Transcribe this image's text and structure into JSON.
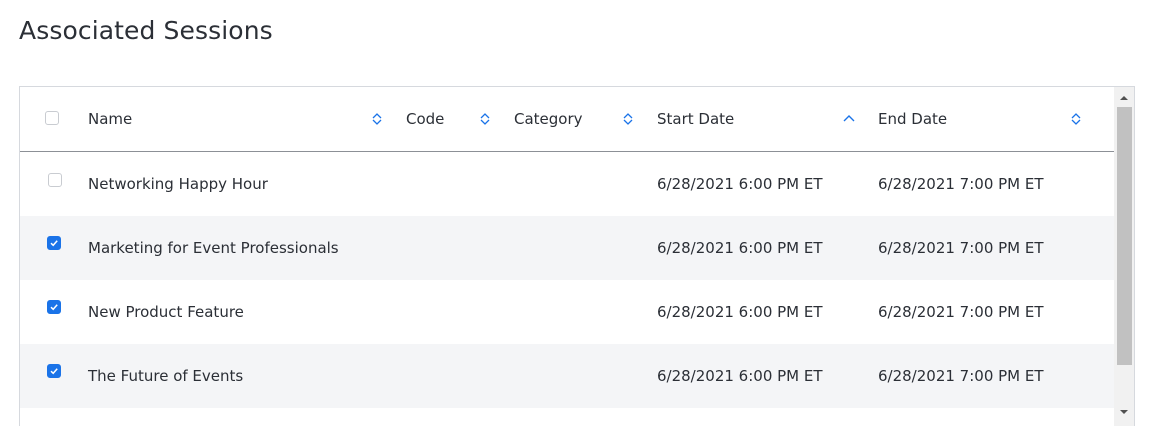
{
  "page": {
    "title": "Associated Sessions"
  },
  "table": {
    "columns": [
      {
        "key": "name",
        "label": "Name",
        "sort": "none"
      },
      {
        "key": "code",
        "label": "Code",
        "sort": "none"
      },
      {
        "key": "category",
        "label": "Category",
        "sort": "none"
      },
      {
        "key": "start",
        "label": "Start Date",
        "sort": "ascending"
      },
      {
        "key": "end",
        "label": "End Date",
        "sort": "none"
      }
    ],
    "rows": [
      {
        "checked": false,
        "name": "Networking Happy Hour",
        "code": "",
        "category": "",
        "start": "6/28/2021 6:00 PM ET",
        "end": "6/28/2021 7:00 PM ET"
      },
      {
        "checked": true,
        "name": "Marketing for Event Professionals",
        "code": "",
        "category": "",
        "start": "6/28/2021 6:00 PM ET",
        "end": "6/28/2021 7:00 PM ET"
      },
      {
        "checked": true,
        "name": "New Product Feature",
        "code": "",
        "category": "",
        "start": "6/28/2021 6:00 PM ET",
        "end": "6/28/2021 7:00 PM ET"
      },
      {
        "checked": true,
        "name": "The Future of Events",
        "code": "",
        "category": "",
        "start": "6/28/2021 6:00 PM ET",
        "end": "6/28/2021 7:00 PM ET"
      }
    ]
  },
  "icons": {
    "sort": "sort-icon",
    "sort_ascending": "sort-ascending-icon",
    "checkbox_checked": "checkmark-icon",
    "scroll_up": "scroll-up-arrow-icon",
    "scroll_down": "scroll-down-arrow-icon"
  },
  "colors": {
    "accent": "#1a73e8",
    "row_alt": "#f4f5f7",
    "header_rule": "#8c9096",
    "text": "#2b2f36"
  }
}
